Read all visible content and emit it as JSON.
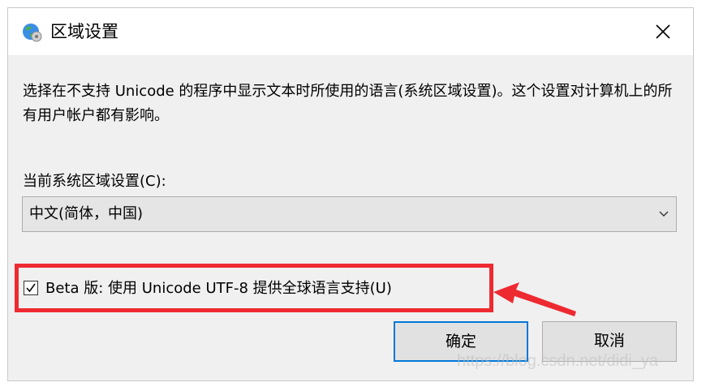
{
  "window": {
    "title": "区域设置",
    "close_icon": "close-icon",
    "title_icon": "globe-icon"
  },
  "description": "选择在不支持 Unicode 的程序中显示文本时所使用的语言(系统区域设置)。这个设置对计算机上的所有用户帐户都有影响。",
  "locale": {
    "label": "当前系统区域设置(C):",
    "selected": "中文(简体，中国)"
  },
  "utf8_option": {
    "label": "Beta 版: 使用 Unicode UTF-8 提供全球语言支持(U)",
    "checked": true
  },
  "buttons": {
    "ok": "确定",
    "cancel": "取消"
  },
  "watermark": "https://blog.csdn.net/didi_ya",
  "colors": {
    "highlight": "#ee2a31",
    "focus_border": "#0078d7"
  }
}
